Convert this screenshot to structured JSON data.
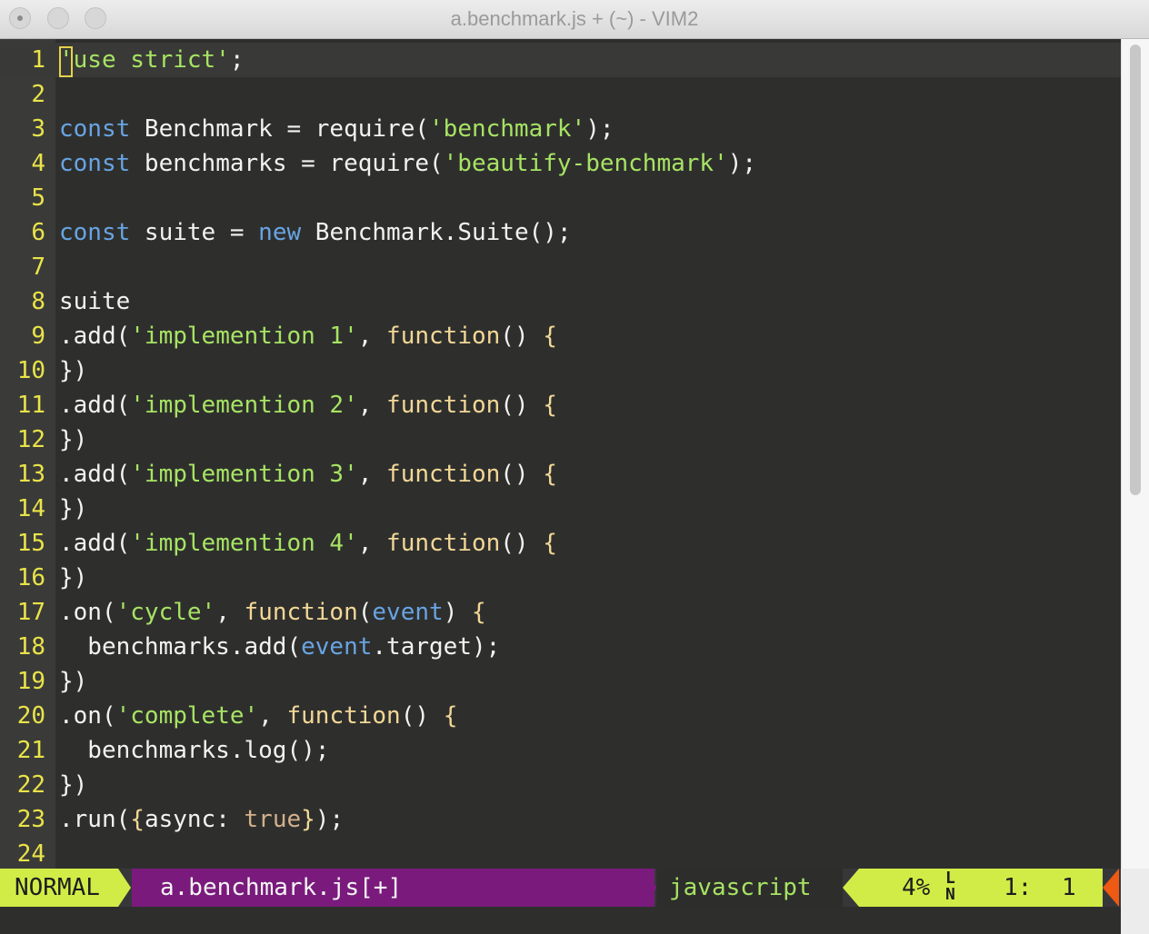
{
  "window": {
    "title": "a.benchmark.js + (~) - VIM2"
  },
  "editor": {
    "lines": [
      {
        "n": "1",
        "tokens": [
          {
            "t": "'use strict'",
            "c": "str"
          },
          {
            "t": ";",
            "c": ""
          }
        ]
      },
      {
        "n": "2",
        "tokens": []
      },
      {
        "n": "3",
        "tokens": [
          {
            "t": "const",
            "c": "kw"
          },
          {
            "t": " Benchmark = require(",
            "c": ""
          },
          {
            "t": "'benchmark'",
            "c": "str"
          },
          {
            "t": ");",
            "c": ""
          }
        ]
      },
      {
        "n": "4",
        "tokens": [
          {
            "t": "const",
            "c": "kw"
          },
          {
            "t": " benchmarks = require(",
            "c": ""
          },
          {
            "t": "'beautify-benchmark'",
            "c": "str"
          },
          {
            "t": ");",
            "c": ""
          }
        ]
      },
      {
        "n": "5",
        "tokens": []
      },
      {
        "n": "6",
        "tokens": [
          {
            "t": "const",
            "c": "kw"
          },
          {
            "t": " suite = ",
            "c": ""
          },
          {
            "t": "new",
            "c": "kw"
          },
          {
            "t": " Benchmark.Suite();",
            "c": ""
          }
        ]
      },
      {
        "n": "7",
        "tokens": []
      },
      {
        "n": "8",
        "tokens": [
          {
            "t": "suite",
            "c": ""
          }
        ]
      },
      {
        "n": "9",
        "tokens": [
          {
            "t": ".add(",
            "c": ""
          },
          {
            "t": "'implemention 1'",
            "c": "str"
          },
          {
            "t": ", ",
            "c": ""
          },
          {
            "t": "function",
            "c": "fn"
          },
          {
            "t": "() ",
            "c": ""
          },
          {
            "t": "{",
            "c": "br"
          }
        ]
      },
      {
        "n": "10",
        "tokens": [
          {
            "t": "})",
            "c": ""
          }
        ]
      },
      {
        "n": "11",
        "tokens": [
          {
            "t": ".add(",
            "c": ""
          },
          {
            "t": "'implemention 2'",
            "c": "str"
          },
          {
            "t": ", ",
            "c": ""
          },
          {
            "t": "function",
            "c": "fn"
          },
          {
            "t": "() ",
            "c": ""
          },
          {
            "t": "{",
            "c": "br"
          }
        ]
      },
      {
        "n": "12",
        "tokens": [
          {
            "t": "})",
            "c": ""
          }
        ]
      },
      {
        "n": "13",
        "tokens": [
          {
            "t": ".add(",
            "c": ""
          },
          {
            "t": "'implemention 3'",
            "c": "str"
          },
          {
            "t": ", ",
            "c": ""
          },
          {
            "t": "function",
            "c": "fn"
          },
          {
            "t": "() ",
            "c": ""
          },
          {
            "t": "{",
            "c": "br"
          }
        ]
      },
      {
        "n": "14",
        "tokens": [
          {
            "t": "})",
            "c": ""
          }
        ]
      },
      {
        "n": "15",
        "tokens": [
          {
            "t": ".add(",
            "c": ""
          },
          {
            "t": "'implemention 4'",
            "c": "str"
          },
          {
            "t": ", ",
            "c": ""
          },
          {
            "t": "function",
            "c": "fn"
          },
          {
            "t": "() ",
            "c": ""
          },
          {
            "t": "{",
            "c": "br"
          }
        ]
      },
      {
        "n": "16",
        "tokens": [
          {
            "t": "})",
            "c": ""
          }
        ]
      },
      {
        "n": "17",
        "tokens": [
          {
            "t": ".on(",
            "c": ""
          },
          {
            "t": "'cycle'",
            "c": "str"
          },
          {
            "t": ", ",
            "c": ""
          },
          {
            "t": "function",
            "c": "fn"
          },
          {
            "t": "(",
            "c": ""
          },
          {
            "t": "event",
            "c": "kw"
          },
          {
            "t": ") ",
            "c": ""
          },
          {
            "t": "{",
            "c": "br"
          }
        ]
      },
      {
        "n": "18",
        "tokens": [
          {
            "t": "  benchmarks.add(",
            "c": ""
          },
          {
            "t": "event",
            "c": "kw"
          },
          {
            "t": ".target);",
            "c": ""
          }
        ]
      },
      {
        "n": "19",
        "tokens": [
          {
            "t": "})",
            "c": ""
          }
        ]
      },
      {
        "n": "20",
        "tokens": [
          {
            "t": ".on(",
            "c": ""
          },
          {
            "t": "'complete'",
            "c": "str"
          },
          {
            "t": ", ",
            "c": ""
          },
          {
            "t": "function",
            "c": "fn"
          },
          {
            "t": "() ",
            "c": ""
          },
          {
            "t": "{",
            "c": "br"
          }
        ]
      },
      {
        "n": "21",
        "tokens": [
          {
            "t": "  benchmarks.log();",
            "c": ""
          }
        ]
      },
      {
        "n": "22",
        "tokens": [
          {
            "t": "})",
            "c": ""
          }
        ]
      },
      {
        "n": "23",
        "tokens": [
          {
            "t": ".run(",
            "c": ""
          },
          {
            "t": "{",
            "c": "br"
          },
          {
            "t": "async: ",
            "c": ""
          },
          {
            "t": "true",
            "c": "bool"
          },
          {
            "t": "}",
            "c": "br"
          },
          {
            "t": ");",
            "c": ""
          }
        ]
      },
      {
        "n": "24",
        "tokens": []
      }
    ]
  },
  "statusline": {
    "mode": "NORMAL",
    "filename": "a.benchmark.js[+]",
    "filetype": "javascript",
    "percent": "4%",
    "line": "1:",
    "column": "1"
  },
  "colors": {
    "mode_bg": "#d2ec47",
    "file_bg": "#7a1a7c",
    "line_number": "#eae34a",
    "keyword": "#68a4e3",
    "string": "#a7e363",
    "editor_bg": "#2e2f2d"
  }
}
